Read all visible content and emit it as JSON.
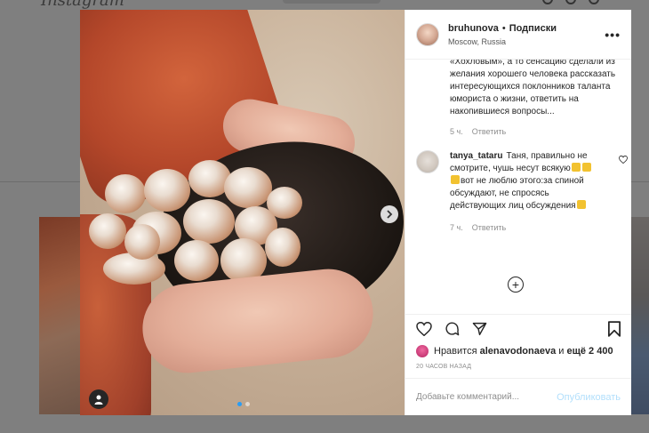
{
  "background": {
    "logo_text": "Instagram"
  },
  "post": {
    "author": "bruhunova",
    "separator": "•",
    "follow_label": "Подписки",
    "location": "Moscow, Russia",
    "more_icon": "more-dots-icon"
  },
  "caption": {
    "text": "«Хохловым», а то сенсацию сделали из желания хорошего человека рассказать интересующихся поклонников таланта юмориста о жизни, ответить на накопившиеся вопросы...",
    "time": "5 ч.",
    "reply_label": "Ответить"
  },
  "comments": [
    {
      "user": "tanya_tataru",
      "text_parts": [
        "Таня, правильно не смотрите, чушь несут всякую",
        "вот не люблю этого:за спиной обсуждают, не спросясь действующих лиц обсуждения"
      ],
      "time": "7 ч.",
      "reply_label": "Ответить"
    }
  ],
  "likes": {
    "prefix": "Нравится",
    "user": "alenavodonaeva",
    "and_label": "и",
    "others": "ещё 2 400"
  },
  "posted_ago": "20 ЧАСОВ НАЗАД",
  "add_comment": {
    "placeholder": "Добавьте комментарий...",
    "publish_label": "Опубликовать"
  },
  "colors": {
    "accent": "#0095f6",
    "publish_disabled": "#b2dffc",
    "overlay": "#7f7f7f"
  }
}
